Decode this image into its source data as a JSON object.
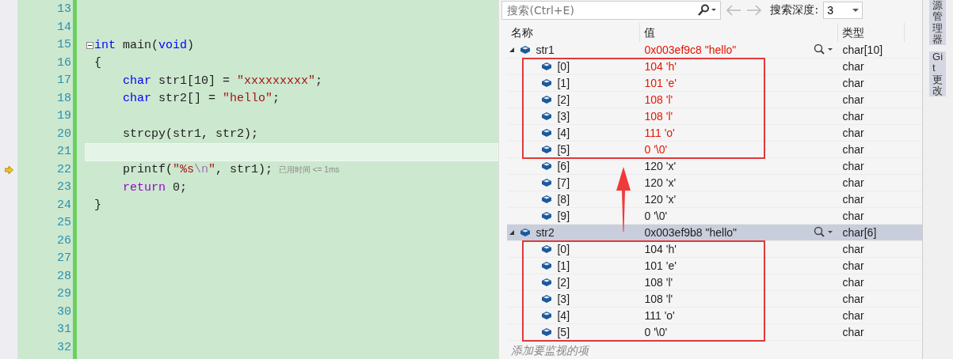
{
  "editor": {
    "lines": [
      {
        "number": "13",
        "current": false,
        "execution_point": false,
        "foldable": false
      },
      {
        "number": "14",
        "current": false,
        "execution_point": false,
        "foldable": false
      },
      {
        "number": "15",
        "current": false,
        "execution_point": false,
        "foldable": true,
        "indented": false,
        "tokens": [
          {
            "kind": "keyword",
            "text": "int"
          },
          {
            "kind": "plain",
            "text": " main("
          },
          {
            "kind": "keyword",
            "text": "void"
          },
          {
            "kind": "plain",
            "text": ")"
          }
        ]
      },
      {
        "number": "16",
        "current": false,
        "execution_point": false,
        "foldable": false,
        "indented": false,
        "tokens": [
          {
            "kind": "plain",
            "text": "{"
          }
        ]
      },
      {
        "number": "17",
        "current": false,
        "execution_point": false,
        "foldable": false,
        "indented": true,
        "tokens": [
          {
            "kind": "keyword",
            "text": "char"
          },
          {
            "kind": "plain",
            "text": " str1[10] = "
          },
          {
            "kind": "string",
            "text": "\"xxxxxxxxx\""
          },
          {
            "kind": "plain",
            "text": ";"
          }
        ]
      },
      {
        "number": "18",
        "current": false,
        "execution_point": false,
        "foldable": false,
        "indented": true,
        "tokens": [
          {
            "kind": "keyword",
            "text": "char"
          },
          {
            "kind": "plain",
            "text": " str2[] = "
          },
          {
            "kind": "string",
            "text": "\"hello\""
          },
          {
            "kind": "plain",
            "text": ";"
          }
        ]
      },
      {
        "number": "19",
        "current": false,
        "execution_point": false,
        "foldable": false
      },
      {
        "number": "20",
        "current": false,
        "execution_point": false,
        "foldable": false,
        "indented": true,
        "tokens": [
          {
            "kind": "plain",
            "text": "strcpy(str1, str2);"
          }
        ]
      },
      {
        "number": "21",
        "current": true,
        "execution_point": false,
        "foldable": false
      },
      {
        "number": "22",
        "current": false,
        "execution_point": true,
        "foldable": false,
        "indented": true,
        "tokens": [
          {
            "kind": "plain",
            "text": "printf("
          },
          {
            "kind": "string",
            "text": "\"%s"
          },
          {
            "kind": "escape",
            "text": "\\n"
          },
          {
            "kind": "string",
            "text": "\""
          },
          {
            "kind": "plain",
            "text": ", str1);"
          }
        ],
        "hint": "已用时间 <= 1ms"
      },
      {
        "number": "23",
        "current": false,
        "execution_point": false,
        "foldable": false,
        "indented": true,
        "tokens": [
          {
            "kind": "control",
            "text": "return"
          },
          {
            "kind": "plain",
            "text": " 0;"
          }
        ]
      },
      {
        "number": "24",
        "current": false,
        "execution_point": false,
        "foldable": false,
        "indented": false,
        "tokens": [
          {
            "kind": "plain",
            "text": "}"
          }
        ]
      },
      {
        "number": "25",
        "current": false,
        "execution_point": false,
        "foldable": false
      },
      {
        "number": "26",
        "current": false,
        "execution_point": false,
        "foldable": false
      },
      {
        "number": "27",
        "current": false,
        "execution_point": false,
        "foldable": false
      },
      {
        "number": "28",
        "current": false,
        "execution_point": false,
        "foldable": false
      },
      {
        "number": "29",
        "current": false,
        "execution_point": false,
        "foldable": false
      },
      {
        "number": "30",
        "current": false,
        "execution_point": false,
        "foldable": false
      },
      {
        "number": "31",
        "current": false,
        "execution_point": false,
        "foldable": false
      },
      {
        "number": "32",
        "current": false,
        "execution_point": false,
        "foldable": false
      }
    ]
  },
  "watch": {
    "search": {
      "placeholder": "搜索(Ctrl+E)"
    },
    "depth_label": "搜索深度:",
    "depth_value": "3",
    "columns": [
      "名称",
      "值",
      "类型"
    ],
    "variables": [
      {
        "name": "str1",
        "value": "0x003ef9c8 \"hello\"",
        "type": "char[10]",
        "changed": true,
        "expanded": true,
        "selected": false,
        "child_groups": [
          {
            "boxed": true,
            "children": [
              {
                "name": "[0]",
                "value": "104 'h'",
                "type": "char",
                "changed": true
              },
              {
                "name": "[1]",
                "value": "101 'e'",
                "type": "char",
                "changed": true
              },
              {
                "name": "[2]",
                "value": "108 'l'",
                "type": "char",
                "changed": true
              },
              {
                "name": "[3]",
                "value": "108 'l'",
                "type": "char",
                "changed": true
              },
              {
                "name": "[4]",
                "value": "111 'o'",
                "type": "char",
                "changed": true
              },
              {
                "name": "[5]",
                "value": "0 '\\0'",
                "type": "char",
                "changed": true
              }
            ]
          },
          {
            "boxed": false,
            "children": [
              {
                "name": "[6]",
                "value": "120 'x'",
                "type": "char",
                "changed": false
              },
              {
                "name": "[7]",
                "value": "120 'x'",
                "type": "char",
                "changed": false
              },
              {
                "name": "[8]",
                "value": "120 'x'",
                "type": "char",
                "changed": false
              },
              {
                "name": "[9]",
                "value": "0 '\\0'",
                "type": "char",
                "changed": false
              }
            ]
          }
        ]
      },
      {
        "name": "str2",
        "value": "0x003ef9b8 \"hello\"",
        "type": "char[6]",
        "changed": false,
        "expanded": true,
        "selected": true,
        "child_groups": [
          {
            "boxed": true,
            "children": [
              {
                "name": "[0]",
                "value": "104 'h'",
                "type": "char",
                "changed": false
              },
              {
                "name": "[1]",
                "value": "101 'e'",
                "type": "char",
                "changed": false
              },
              {
                "name": "[2]",
                "value": "108 'l'",
                "type": "char",
                "changed": false
              },
              {
                "name": "[3]",
                "value": "108 'l'",
                "type": "char",
                "changed": false
              },
              {
                "name": "[4]",
                "value": "111 'o'",
                "type": "char",
                "changed": false
              },
              {
                "name": "[5]",
                "value": "0 '\\0'",
                "type": "char",
                "changed": false
              }
            ]
          }
        ]
      }
    ],
    "annotation_arrow": true,
    "add_placeholder": "添加要监视的项"
  },
  "side_tabs": [
    "源管理器",
    "Git 更改"
  ]
}
